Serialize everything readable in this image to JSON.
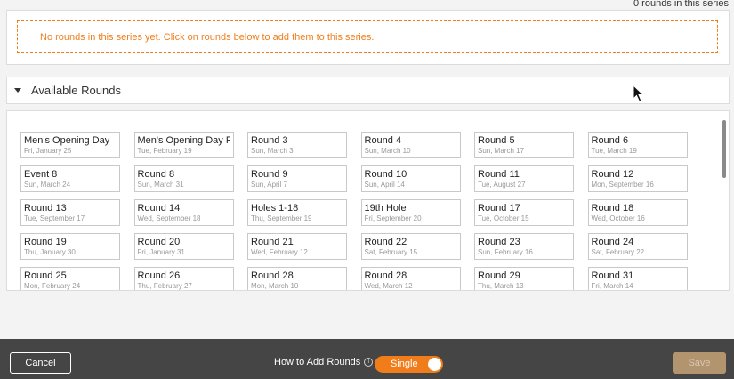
{
  "series": {
    "rounds_count": "0 rounds in this series",
    "empty_message": "No rounds in this series yet. Click on rounds below to add them to this series."
  },
  "available": {
    "title": "Available Rounds",
    "rounds": [
      {
        "name": "Men's Opening Day",
        "date": "Fri, January 25"
      },
      {
        "name": "Men's Opening Day Rc",
        "date": "Tue, February 19"
      },
      {
        "name": "Round 3",
        "date": "Sun, March 3"
      },
      {
        "name": "Round 4",
        "date": "Sun, March 10"
      },
      {
        "name": "Round 5",
        "date": "Sun, March 17"
      },
      {
        "name": "Round 6",
        "date": "Tue, March 19"
      },
      {
        "name": "Event 8",
        "date": "Sun, March 24"
      },
      {
        "name": "Round 8",
        "date": "Sun, March 31"
      },
      {
        "name": "Round 9",
        "date": "Sun, April 7"
      },
      {
        "name": "Round 10",
        "date": "Sun, April 14"
      },
      {
        "name": "Round 11",
        "date": "Tue, August 27"
      },
      {
        "name": "Round 12",
        "date": "Mon, September 16"
      },
      {
        "name": "Round 13",
        "date": "Tue, September 17"
      },
      {
        "name": "Round 14",
        "date": "Wed, September 18"
      },
      {
        "name": "Holes 1-18",
        "date": "Thu, September 19"
      },
      {
        "name": "19th Hole",
        "date": "Fri, September 20"
      },
      {
        "name": "Round 17",
        "date": "Tue, October 15"
      },
      {
        "name": "Round 18",
        "date": "Wed, October 16"
      },
      {
        "name": "Round 19",
        "date": "Thu, January 30"
      },
      {
        "name": "Round 20",
        "date": "Fri, January 31"
      },
      {
        "name": "Round 21",
        "date": "Wed, February 12"
      },
      {
        "name": "Round 22",
        "date": "Sat, February 15"
      },
      {
        "name": "Round 23",
        "date": "Sun, February 16"
      },
      {
        "name": "Round 24",
        "date": "Sat, February 22"
      },
      {
        "name": "Round 25",
        "date": "Mon, February 24"
      },
      {
        "name": "Round 26",
        "date": "Thu, February 27"
      },
      {
        "name": "Round 28",
        "date": "Mon, March 10"
      },
      {
        "name": "Round 28",
        "date": "Wed, March 12"
      },
      {
        "name": "Round 29",
        "date": "Thu, March 13"
      },
      {
        "name": "Round 31",
        "date": "Fri, March 14"
      }
    ]
  },
  "footer": {
    "cancel_label": "Cancel",
    "how_to_label": "How to Add Rounds",
    "info_icon": "i",
    "toggle_label": "Single",
    "save_label": "Save"
  },
  "colors": {
    "accent": "#f07d1a",
    "footer_bg": "#454545",
    "save_disabled": "#b2946f"
  },
  "icons": {
    "expand": "caret-down-icon",
    "info": "info-icon",
    "pointer": "mouse-pointer-icon"
  }
}
